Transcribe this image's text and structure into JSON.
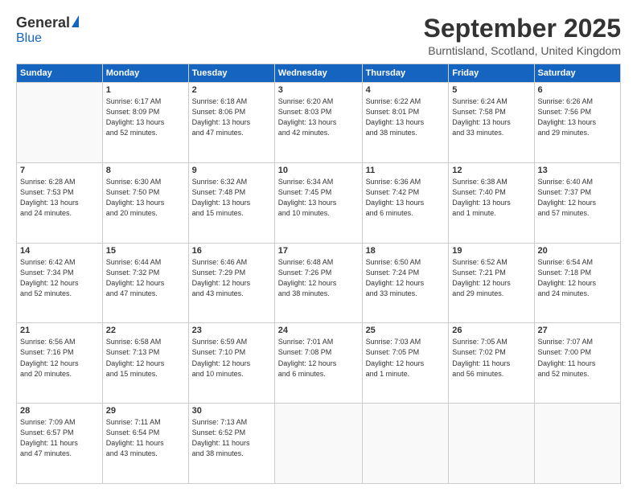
{
  "header": {
    "logo_general": "General",
    "logo_blue": "Blue",
    "month_title": "September 2025",
    "location": "Burntisland, Scotland, United Kingdom"
  },
  "days_of_week": [
    "Sunday",
    "Monday",
    "Tuesday",
    "Wednesday",
    "Thursday",
    "Friday",
    "Saturday"
  ],
  "weeks": [
    [
      {
        "day": "",
        "info": ""
      },
      {
        "day": "1",
        "info": "Sunrise: 6:17 AM\nSunset: 8:09 PM\nDaylight: 13 hours\nand 52 minutes."
      },
      {
        "day": "2",
        "info": "Sunrise: 6:18 AM\nSunset: 8:06 PM\nDaylight: 13 hours\nand 47 minutes."
      },
      {
        "day": "3",
        "info": "Sunrise: 6:20 AM\nSunset: 8:03 PM\nDaylight: 13 hours\nand 42 minutes."
      },
      {
        "day": "4",
        "info": "Sunrise: 6:22 AM\nSunset: 8:01 PM\nDaylight: 13 hours\nand 38 minutes."
      },
      {
        "day": "5",
        "info": "Sunrise: 6:24 AM\nSunset: 7:58 PM\nDaylight: 13 hours\nand 33 minutes."
      },
      {
        "day": "6",
        "info": "Sunrise: 6:26 AM\nSunset: 7:56 PM\nDaylight: 13 hours\nand 29 minutes."
      }
    ],
    [
      {
        "day": "7",
        "info": "Sunrise: 6:28 AM\nSunset: 7:53 PM\nDaylight: 13 hours\nand 24 minutes."
      },
      {
        "day": "8",
        "info": "Sunrise: 6:30 AM\nSunset: 7:50 PM\nDaylight: 13 hours\nand 20 minutes."
      },
      {
        "day": "9",
        "info": "Sunrise: 6:32 AM\nSunset: 7:48 PM\nDaylight: 13 hours\nand 15 minutes."
      },
      {
        "day": "10",
        "info": "Sunrise: 6:34 AM\nSunset: 7:45 PM\nDaylight: 13 hours\nand 10 minutes."
      },
      {
        "day": "11",
        "info": "Sunrise: 6:36 AM\nSunset: 7:42 PM\nDaylight: 13 hours\nand 6 minutes."
      },
      {
        "day": "12",
        "info": "Sunrise: 6:38 AM\nSunset: 7:40 PM\nDaylight: 13 hours\nand 1 minute."
      },
      {
        "day": "13",
        "info": "Sunrise: 6:40 AM\nSunset: 7:37 PM\nDaylight: 12 hours\nand 57 minutes."
      }
    ],
    [
      {
        "day": "14",
        "info": "Sunrise: 6:42 AM\nSunset: 7:34 PM\nDaylight: 12 hours\nand 52 minutes."
      },
      {
        "day": "15",
        "info": "Sunrise: 6:44 AM\nSunset: 7:32 PM\nDaylight: 12 hours\nand 47 minutes."
      },
      {
        "day": "16",
        "info": "Sunrise: 6:46 AM\nSunset: 7:29 PM\nDaylight: 12 hours\nand 43 minutes."
      },
      {
        "day": "17",
        "info": "Sunrise: 6:48 AM\nSunset: 7:26 PM\nDaylight: 12 hours\nand 38 minutes."
      },
      {
        "day": "18",
        "info": "Sunrise: 6:50 AM\nSunset: 7:24 PM\nDaylight: 12 hours\nand 33 minutes."
      },
      {
        "day": "19",
        "info": "Sunrise: 6:52 AM\nSunset: 7:21 PM\nDaylight: 12 hours\nand 29 minutes."
      },
      {
        "day": "20",
        "info": "Sunrise: 6:54 AM\nSunset: 7:18 PM\nDaylight: 12 hours\nand 24 minutes."
      }
    ],
    [
      {
        "day": "21",
        "info": "Sunrise: 6:56 AM\nSunset: 7:16 PM\nDaylight: 12 hours\nand 20 minutes."
      },
      {
        "day": "22",
        "info": "Sunrise: 6:58 AM\nSunset: 7:13 PM\nDaylight: 12 hours\nand 15 minutes."
      },
      {
        "day": "23",
        "info": "Sunrise: 6:59 AM\nSunset: 7:10 PM\nDaylight: 12 hours\nand 10 minutes."
      },
      {
        "day": "24",
        "info": "Sunrise: 7:01 AM\nSunset: 7:08 PM\nDaylight: 12 hours\nand 6 minutes."
      },
      {
        "day": "25",
        "info": "Sunrise: 7:03 AM\nSunset: 7:05 PM\nDaylight: 12 hours\nand 1 minute."
      },
      {
        "day": "26",
        "info": "Sunrise: 7:05 AM\nSunset: 7:02 PM\nDaylight: 11 hours\nand 56 minutes."
      },
      {
        "day": "27",
        "info": "Sunrise: 7:07 AM\nSunset: 7:00 PM\nDaylight: 11 hours\nand 52 minutes."
      }
    ],
    [
      {
        "day": "28",
        "info": "Sunrise: 7:09 AM\nSunset: 6:57 PM\nDaylight: 11 hours\nand 47 minutes."
      },
      {
        "day": "29",
        "info": "Sunrise: 7:11 AM\nSunset: 6:54 PM\nDaylight: 11 hours\nand 43 minutes."
      },
      {
        "day": "30",
        "info": "Sunrise: 7:13 AM\nSunset: 6:52 PM\nDaylight: 11 hours\nand 38 minutes."
      },
      {
        "day": "",
        "info": ""
      },
      {
        "day": "",
        "info": ""
      },
      {
        "day": "",
        "info": ""
      },
      {
        "day": "",
        "info": ""
      }
    ]
  ]
}
